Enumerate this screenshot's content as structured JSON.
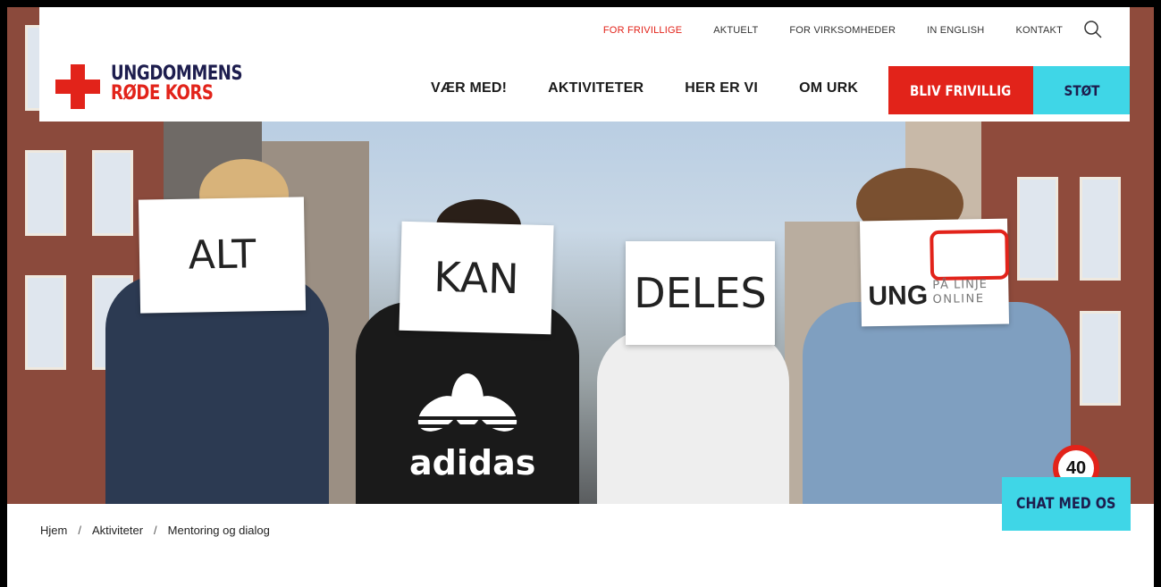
{
  "top_nav": {
    "items": [
      "FOR FRIVILLIGE",
      "AKTUELT",
      "FOR VIRKSOMHEDER",
      "IN ENGLISH",
      "KONTAKT"
    ],
    "active": "FOR FRIVILLIGE"
  },
  "logo": {
    "line1": "UNGDOMMENS",
    "line2": "RØDE KORS"
  },
  "main_nav": {
    "items": [
      "VÆR MED!",
      "AKTIVITETER",
      "HER ER VI",
      "OM URK"
    ]
  },
  "buttons": {
    "volunteer": "BLIV FRIVILLIG",
    "support": "STØT",
    "chat": "CHAT MED OS"
  },
  "hero": {
    "signs": [
      "ALT",
      "KAN",
      "DELES"
    ],
    "ung_sign": {
      "main": "UNG",
      "line1": "PÅ LINJE",
      "line2": "ONLINE"
    },
    "shirt_text": "adidas",
    "speed_sign": "40"
  },
  "breadcrumb": [
    "Hjem",
    "Aktiviteter",
    "Mentoring og dialog"
  ],
  "colors": {
    "red": "#e2231a",
    "cyan": "#3fd6e7",
    "navy": "#1d1d4e"
  }
}
